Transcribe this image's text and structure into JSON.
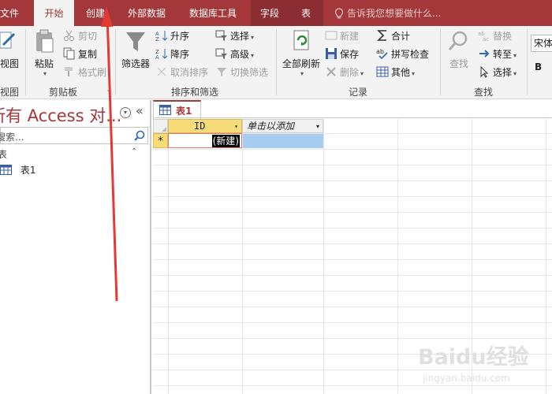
{
  "tabs": {
    "file": "文件",
    "home": "开始",
    "create": "创建",
    "external": "外部数据",
    "dbtools": "数据库工具",
    "fields": "字段",
    "table": "表",
    "tell_me": "告诉我您想要做什么..."
  },
  "ribbon": {
    "views": {
      "view_label": "视图",
      "group_label": "视图"
    },
    "clipboard": {
      "paste": "粘贴",
      "cut": "剪切",
      "copy": "复制",
      "format_painter": "格式刷",
      "group_label": "剪贴板"
    },
    "sort_filter": {
      "filter": "筛选器",
      "ascending": "升序",
      "descending": "降序",
      "clear_sort": "取消排序",
      "selection": "选择",
      "advanced": "高级",
      "toggle_filter": "切换筛选",
      "group_label": "排序和筛选"
    },
    "records": {
      "refresh_all": "全部刷新",
      "new": "新建",
      "save": "保存",
      "delete": "删除",
      "totals": "合计",
      "spelling": "拼写检查",
      "more": "其他",
      "group_label": "记录"
    },
    "find": {
      "find": "查找",
      "replace": "替换",
      "goto": "转至",
      "select": "选择",
      "group_label": "查找"
    },
    "font": {
      "font_name": "宋体",
      "bold": "B"
    }
  },
  "nav_pane": {
    "title": "所有 Access 对...",
    "search_placeholder": "搜索...",
    "section": "表",
    "items": [
      "表1"
    ]
  },
  "document": {
    "tab_label": "表1",
    "columns": [
      "ID",
      "单击以添加"
    ],
    "new_row_marker": "*",
    "new_row_value": "(新建)"
  },
  "watermark": {
    "brand": "Baidu经验",
    "url": "jingyan.baidu.com"
  },
  "colors": {
    "accent": "#a4373a",
    "header_yellow": "#f7dc7a",
    "selected_cell": "#a7cdf0"
  }
}
